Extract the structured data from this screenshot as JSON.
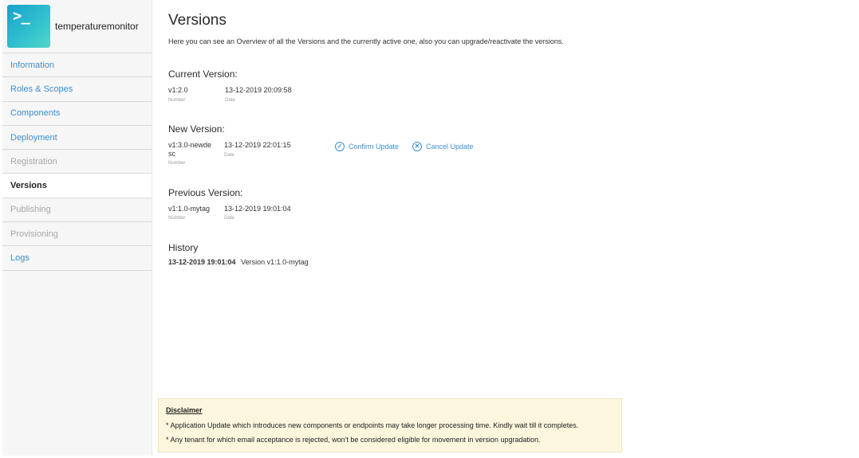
{
  "app": {
    "name": "temperaturemonitor",
    "logo_glyph": ">_"
  },
  "sidebar": {
    "items": [
      {
        "label": "Information",
        "state": "link"
      },
      {
        "label": "Roles & Scopes",
        "state": "link"
      },
      {
        "label": "Components",
        "state": "link"
      },
      {
        "label": "Deployment",
        "state": "link"
      },
      {
        "label": "Registration",
        "state": "disabled"
      },
      {
        "label": "Versions",
        "state": "active"
      },
      {
        "label": "Publishing",
        "state": "disabled"
      },
      {
        "label": "Provisioning",
        "state": "disabled"
      },
      {
        "label": "Logs",
        "state": "link"
      }
    ]
  },
  "page": {
    "title": "Versions",
    "description": "Here you can see an Overview of all the Versions and the currently active one, also you can upgrade/reactivate the versions."
  },
  "current": {
    "title": "Current Version:",
    "number": "v1:2.0",
    "number_label": "Number",
    "date": "13-12-2019 20:09:58",
    "date_label": "Date"
  },
  "new_version": {
    "title": "New Version:",
    "number_line1": "v1:3.0-newde",
    "number_line2": "sc",
    "number_label": "Number",
    "date": "13-12-2019 22:01:15",
    "date_label": "Date",
    "confirm_label": "Confirm Update",
    "cancel_label": "Cancel Update",
    "confirm_icon": "check-circle-icon",
    "cancel_icon": "x-circle-icon"
  },
  "previous": {
    "title": "Previous Version:",
    "number": "v1:1.0-mytag",
    "number_label": "Number",
    "date": "13-12-2019 19:01:04",
    "date_label": "Date"
  },
  "history": {
    "title": "History",
    "entries": [
      {
        "date": "13-12-2019 19:01:04",
        "text": "Version v1:1.0-mytag"
      }
    ]
  },
  "disclaimer": {
    "title": "Disclaimer",
    "lines": [
      "* Application Update which introduces new components or endpoints may take longer processing time. Kindly wait till it completes.",
      "* Any tenant for which email acceptance is rejected, won't be considered eligible for movement in version upgradation."
    ]
  },
  "colors": {
    "link": "#3d8fd0",
    "disabled": "#a7a7a7",
    "disclaimer_bg": "#fbf6dc"
  }
}
